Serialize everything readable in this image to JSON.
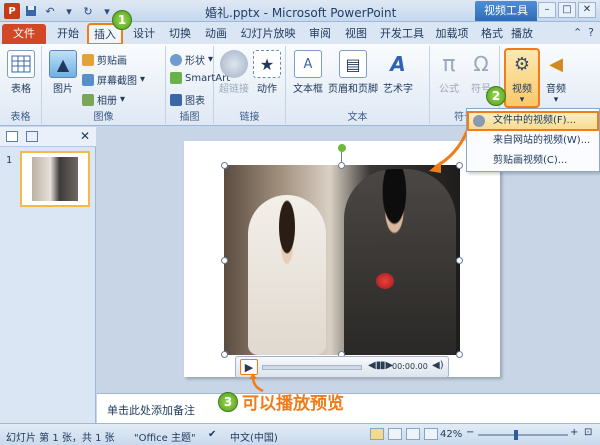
{
  "titlebar": {
    "title": "婚礼.pptx - Microsoft PowerPoint",
    "context_tab": "视频工具",
    "app_icon": "P",
    "window_controls": [
      "minimize-icon",
      "maximize-icon",
      "close-icon"
    ]
  },
  "tabs": {
    "file": "文件",
    "items": [
      "开始",
      "插入",
      "设计",
      "切换",
      "动画",
      "幻灯片放映",
      "审阅",
      "视图",
      "开发工具",
      "加载项",
      "格式",
      "播放"
    ],
    "active": "插入"
  },
  "ribbon": {
    "groups": {
      "tables": {
        "label": "表格",
        "table": "表格"
      },
      "images": {
        "label": "图像",
        "picture": "图片",
        "clipart": "剪贴画",
        "screenshot": "屏幕截图",
        "album": "相册"
      },
      "illustrations": {
        "label": "插图",
        "shapes": "形状",
        "smartart": "SmartArt",
        "chart": "图表"
      },
      "links": {
        "label": "链接",
        "hyperlink": "超链接",
        "action": "动作"
      },
      "text": {
        "label": "文本",
        "textbox": "文本框",
        "header_footer": "页眉和页脚",
        "wordart": "艺术字"
      },
      "symbols": {
        "label": "符号",
        "equation": "公式",
        "symbol": "符号"
      },
      "media": {
        "video": "视频",
        "audio": "音频"
      }
    }
  },
  "video_menu": {
    "items": [
      "文件中的视频(F)...",
      "来自网站的视频(W)...",
      "剪贴画视频(C)..."
    ],
    "selected_index": 0
  },
  "slide_panel": {
    "slide_number": "1"
  },
  "player": {
    "time": "00:00.00"
  },
  "notes": {
    "placeholder": "单击此处添加备注"
  },
  "callouts": {
    "step1": "1",
    "step2": "2",
    "step3": "3",
    "step3_text": "可以播放预览"
  },
  "status": {
    "slide_info": "幻灯片 第 1 张，共 1 张",
    "theme": "\"Office 主题\"",
    "language": "中文(中国)",
    "zoom": "42%",
    "zoom_fraction": 0.42
  },
  "colors": {
    "accent_orange": "#f07c1a",
    "file_tab": "#d24726",
    "badge_green": "#4e9a1c"
  }
}
